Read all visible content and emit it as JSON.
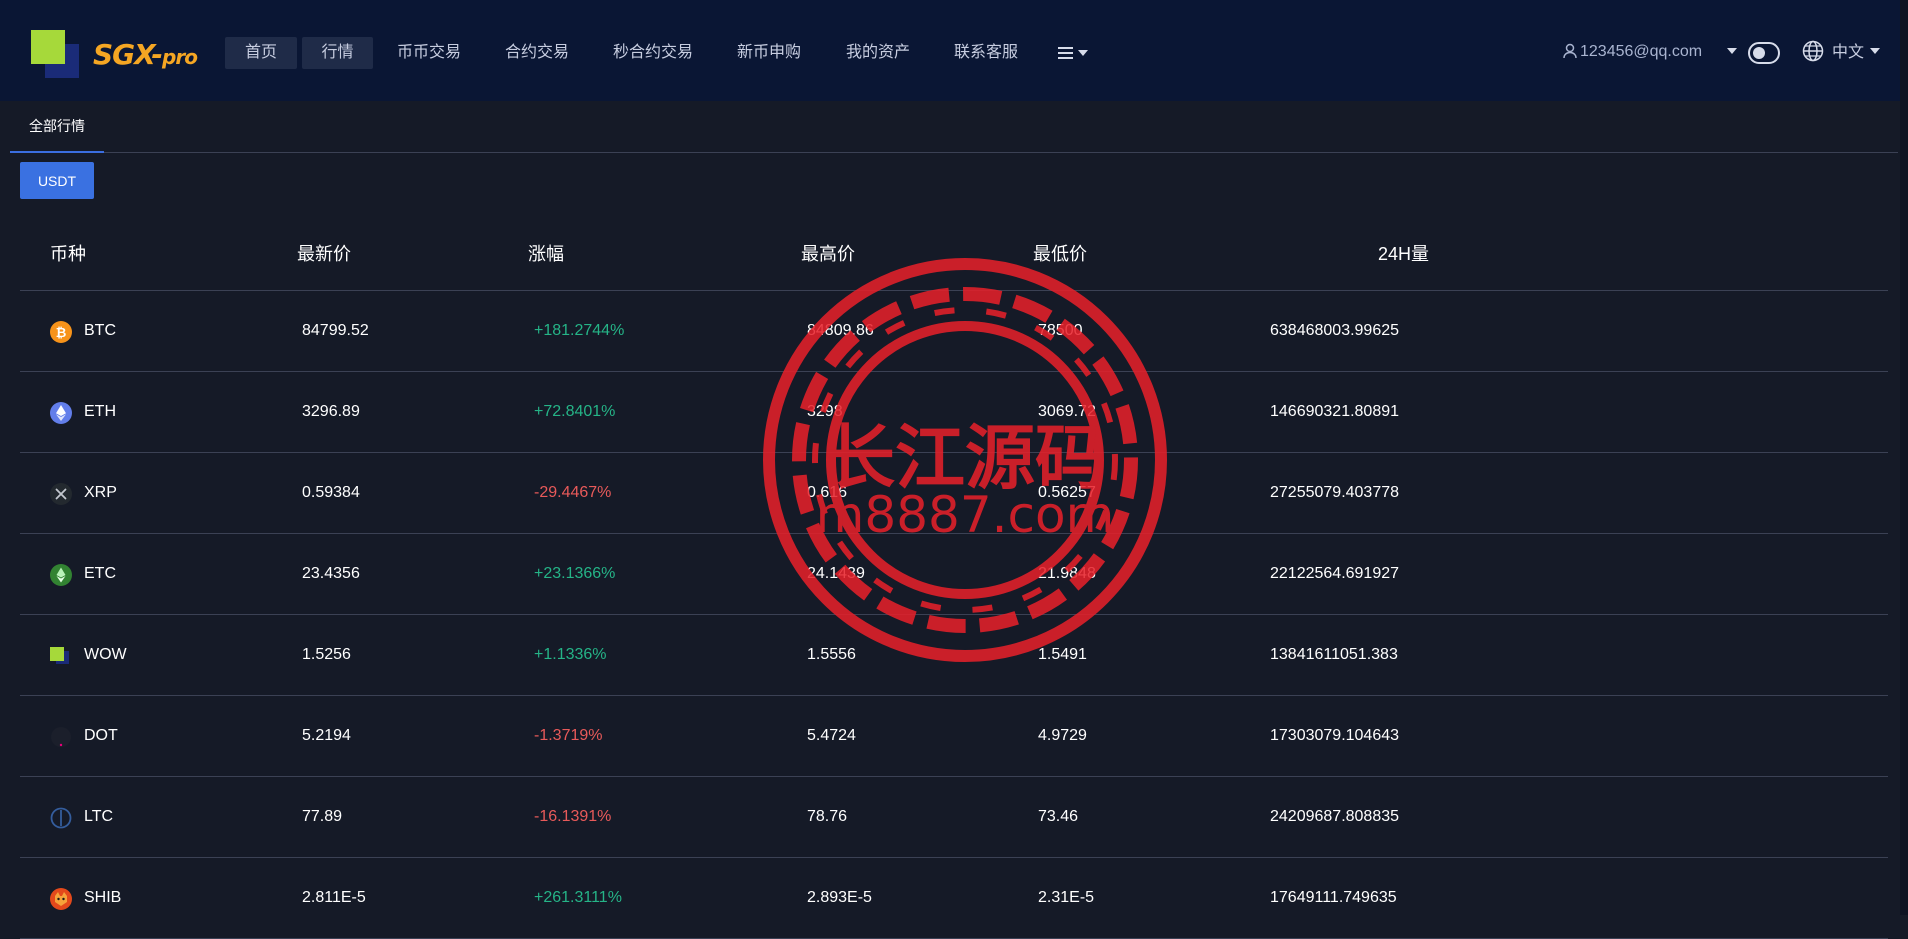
{
  "brand": {
    "name": "SGX-",
    "suffix": "pro"
  },
  "nav": [
    {
      "label": "首页",
      "name": "nav-home"
    },
    {
      "label": "行情",
      "name": "nav-market"
    },
    {
      "label": "币币交易",
      "name": "nav-spot"
    },
    {
      "label": "合约交易",
      "name": "nav-futures"
    },
    {
      "label": "秒合约交易",
      "name": "nav-second-contract"
    },
    {
      "label": "新币申购",
      "name": "nav-ipo"
    },
    {
      "label": "我的资产",
      "name": "nav-assets"
    },
    {
      "label": "联系客服",
      "name": "nav-support"
    }
  ],
  "user": {
    "email": "123456@qq.com"
  },
  "language": "中文",
  "tabs": [
    {
      "label": "全部行情"
    }
  ],
  "quote_button": "USDT",
  "table": {
    "headers": [
      "币种",
      "最新价",
      "涨幅",
      "最高价",
      "最低价",
      "24H量"
    ],
    "rows": [
      {
        "symbol": "BTC",
        "icon": "btc-icon",
        "price": "84799.52",
        "change": "+181.2744%",
        "trend": "up",
        "high": "84809.86",
        "low": "78500",
        "volume": "638468003.99625"
      },
      {
        "symbol": "ETH",
        "icon": "eth-icon",
        "price": "3296.89",
        "change": "+72.8401%",
        "trend": "up",
        "high": "3298",
        "low": "3069.72",
        "volume": "146690321.80891"
      },
      {
        "symbol": "XRP",
        "icon": "xrp-icon",
        "price": "0.59384",
        "change": "-29.4467%",
        "trend": "down",
        "high": "0.616",
        "low": "0.56257",
        "volume": "27255079.403778"
      },
      {
        "symbol": "ETC",
        "icon": "etc-icon",
        "price": "23.4356",
        "change": "+23.1366%",
        "trend": "up",
        "high": "24.1439",
        "low": "21.9848",
        "volume": "22122564.691927"
      },
      {
        "symbol": "WOW",
        "icon": "wow-icon",
        "price": "1.5256",
        "change": "+1.1336%",
        "trend": "up",
        "high": "1.5556",
        "low": "1.5491",
        "volume": "13841611051.383"
      },
      {
        "symbol": "DOT",
        "icon": "dot-icon",
        "price": "5.2194",
        "change": "-1.3719%",
        "trend": "down",
        "high": "5.4724",
        "low": "4.9729",
        "volume": "17303079.104643"
      },
      {
        "symbol": "LTC",
        "icon": "ltc-icon",
        "price": "77.89",
        "change": "-16.1391%",
        "trend": "down",
        "high": "78.76",
        "low": "73.46",
        "volume": "24209687.808835"
      },
      {
        "symbol": "SHIB",
        "icon": "shib-icon",
        "price": "2.811E-5",
        "change": "+261.3111%",
        "trend": "up",
        "high": "2.893E-5",
        "low": "2.31E-5",
        "volume": "17649111.749635"
      }
    ]
  },
  "watermark": {
    "line1": "长江源码",
    "line2": "m8887.com"
  },
  "colors": {
    "nav_bg": "#0a1634",
    "page_bg": "#151a27",
    "accent": "#3a71e1",
    "up": "#25b487",
    "down": "#e85a5a",
    "brand": "#f5a623",
    "stamp": "#e8202a"
  }
}
